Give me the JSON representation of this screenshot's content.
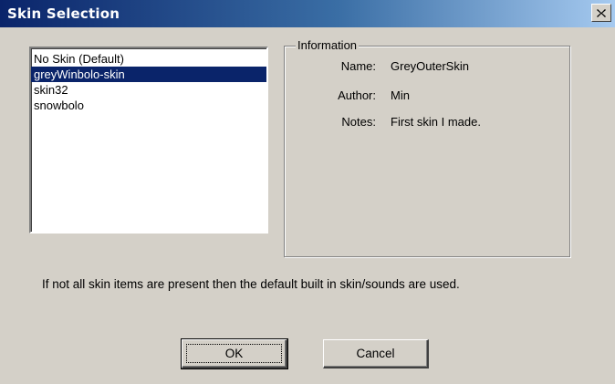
{
  "window": {
    "title": "Skin Selection"
  },
  "icons": {
    "close": "close-icon"
  },
  "skin_list": {
    "items": [
      {
        "label": "No Skin (Default)",
        "selected": false
      },
      {
        "label": "greyWinbolo-skin",
        "selected": true
      },
      {
        "label": "skin32",
        "selected": false
      },
      {
        "label": "snowbolo",
        "selected": false
      }
    ]
  },
  "information": {
    "group_label": "Information",
    "name_label": "Name:",
    "name_value": "GreyOuterSkin",
    "author_label": "Author:",
    "author_value": "Min",
    "notes_label": "Notes:",
    "notes_value": "First skin I made."
  },
  "notice": "If not all skin items are present then the default built in skin/sounds are used.",
  "buttons": {
    "ok_label": "OK",
    "cancel_label": "Cancel"
  },
  "colors": {
    "titlebar_start": "#0a246a",
    "titlebar_end": "#a6caf0",
    "selection": "#0a246a",
    "face": "#d4d0c8"
  }
}
